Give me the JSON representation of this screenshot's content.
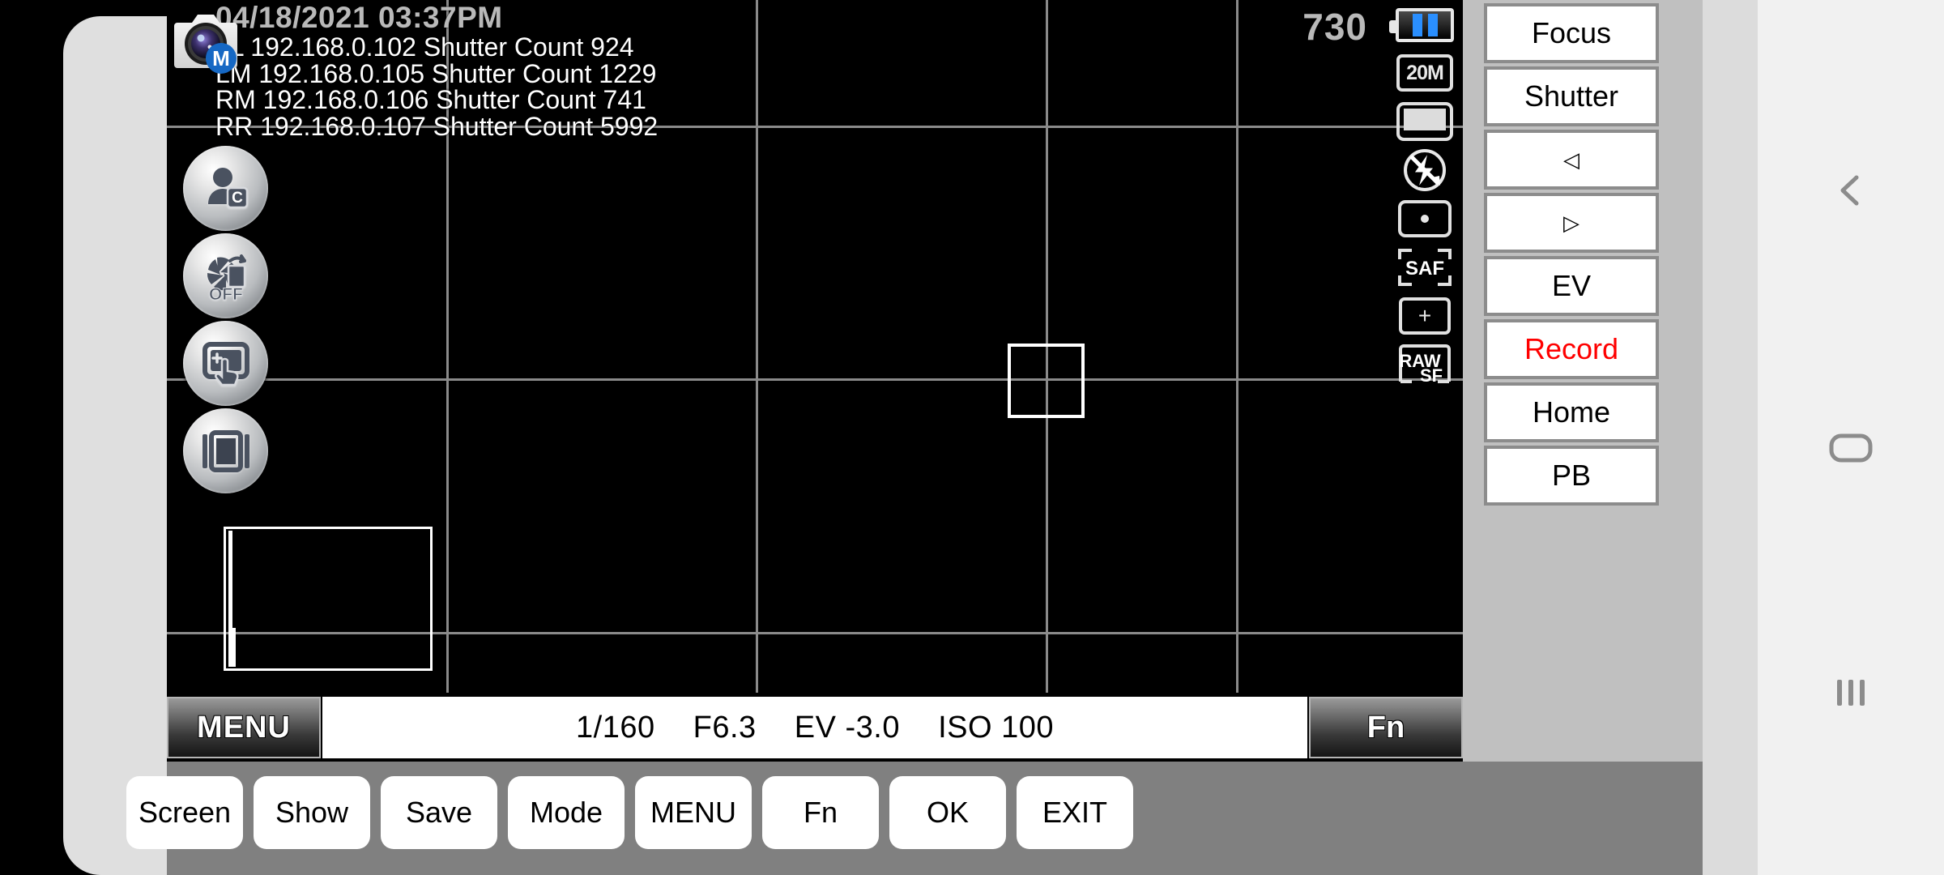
{
  "osd": {
    "datetime": "04/18/2021 03:37PM",
    "camera_lines": [
      "LL 192.168.0.102 Shutter Count 924",
      "LM 192.168.0.105 Shutter Count 1229",
      "RM 192.168.0.106 Shutter Count 741",
      "RR 192.168.0.107 Shutter Count 5992"
    ],
    "shots_remaining": "730",
    "mode_badge": "M"
  },
  "left_buttons": [
    {
      "name": "custom-profile",
      "icon": "person-c-icon"
    },
    {
      "name": "shutter-sound-off",
      "icon": "aperture-off-icon"
    },
    {
      "name": "touch-shutter",
      "icon": "touch-add-icon"
    },
    {
      "name": "display-toggle",
      "icon": "screen-frame-icon"
    }
  ],
  "status_icons": [
    {
      "name": "battery",
      "icon": "battery-icon",
      "label": ""
    },
    {
      "name": "image-size",
      "icon": "image-size-icon",
      "label": "20M"
    },
    {
      "name": "aspect-ratio",
      "icon": "aspect-ratio-icon",
      "label": ""
    },
    {
      "name": "flash-off",
      "icon": "flash-off-icon",
      "label": ""
    },
    {
      "name": "metering-spot",
      "icon": "spot-metering-icon",
      "label": ""
    },
    {
      "name": "focus-mode",
      "icon": "saf-icon",
      "label": "SAF"
    },
    {
      "name": "focus-area",
      "icon": "focus-area-plus-icon",
      "label": "+"
    },
    {
      "name": "quality-raw",
      "icon": "raw-sf-icon",
      "label": "RAW SF"
    }
  ],
  "exposure": {
    "shutter": "1/160",
    "aperture": "F6.3",
    "ev": "EV -3.0",
    "iso": "ISO 100",
    "menu_label": "MENU",
    "fn_label": "Fn"
  },
  "control_panel": [
    {
      "label": "Focus",
      "color": "#000000"
    },
    {
      "label": "Shutter",
      "color": "#000000"
    },
    {
      "label": "◁",
      "color": "#000000"
    },
    {
      "label": "▷",
      "color": "#000000"
    },
    {
      "label": "EV",
      "color": "#000000"
    },
    {
      "label": "Record",
      "color": "#ff0000"
    },
    {
      "label": "Home",
      "color": "#000000"
    },
    {
      "label": "PB",
      "color": "#000000"
    }
  ],
  "toolbar": [
    {
      "label": "Screen"
    },
    {
      "label": "Show"
    },
    {
      "label": "Save"
    },
    {
      "label": "Mode"
    },
    {
      "label": "MENU"
    },
    {
      "label": "Fn"
    },
    {
      "label": "OK"
    },
    {
      "label": "EXIT"
    }
  ],
  "nav": [
    {
      "name": "back",
      "icon": "back-chevron-icon"
    },
    {
      "name": "home",
      "icon": "home-rounded-rect-icon"
    },
    {
      "name": "recents",
      "icon": "recents-bars-icon"
    }
  ],
  "colors": {
    "record_red": "#ff0000",
    "battery_blue": "#2a8fff",
    "panel_gray": "#c0c0c0",
    "toolbar_gray": "#808080"
  }
}
